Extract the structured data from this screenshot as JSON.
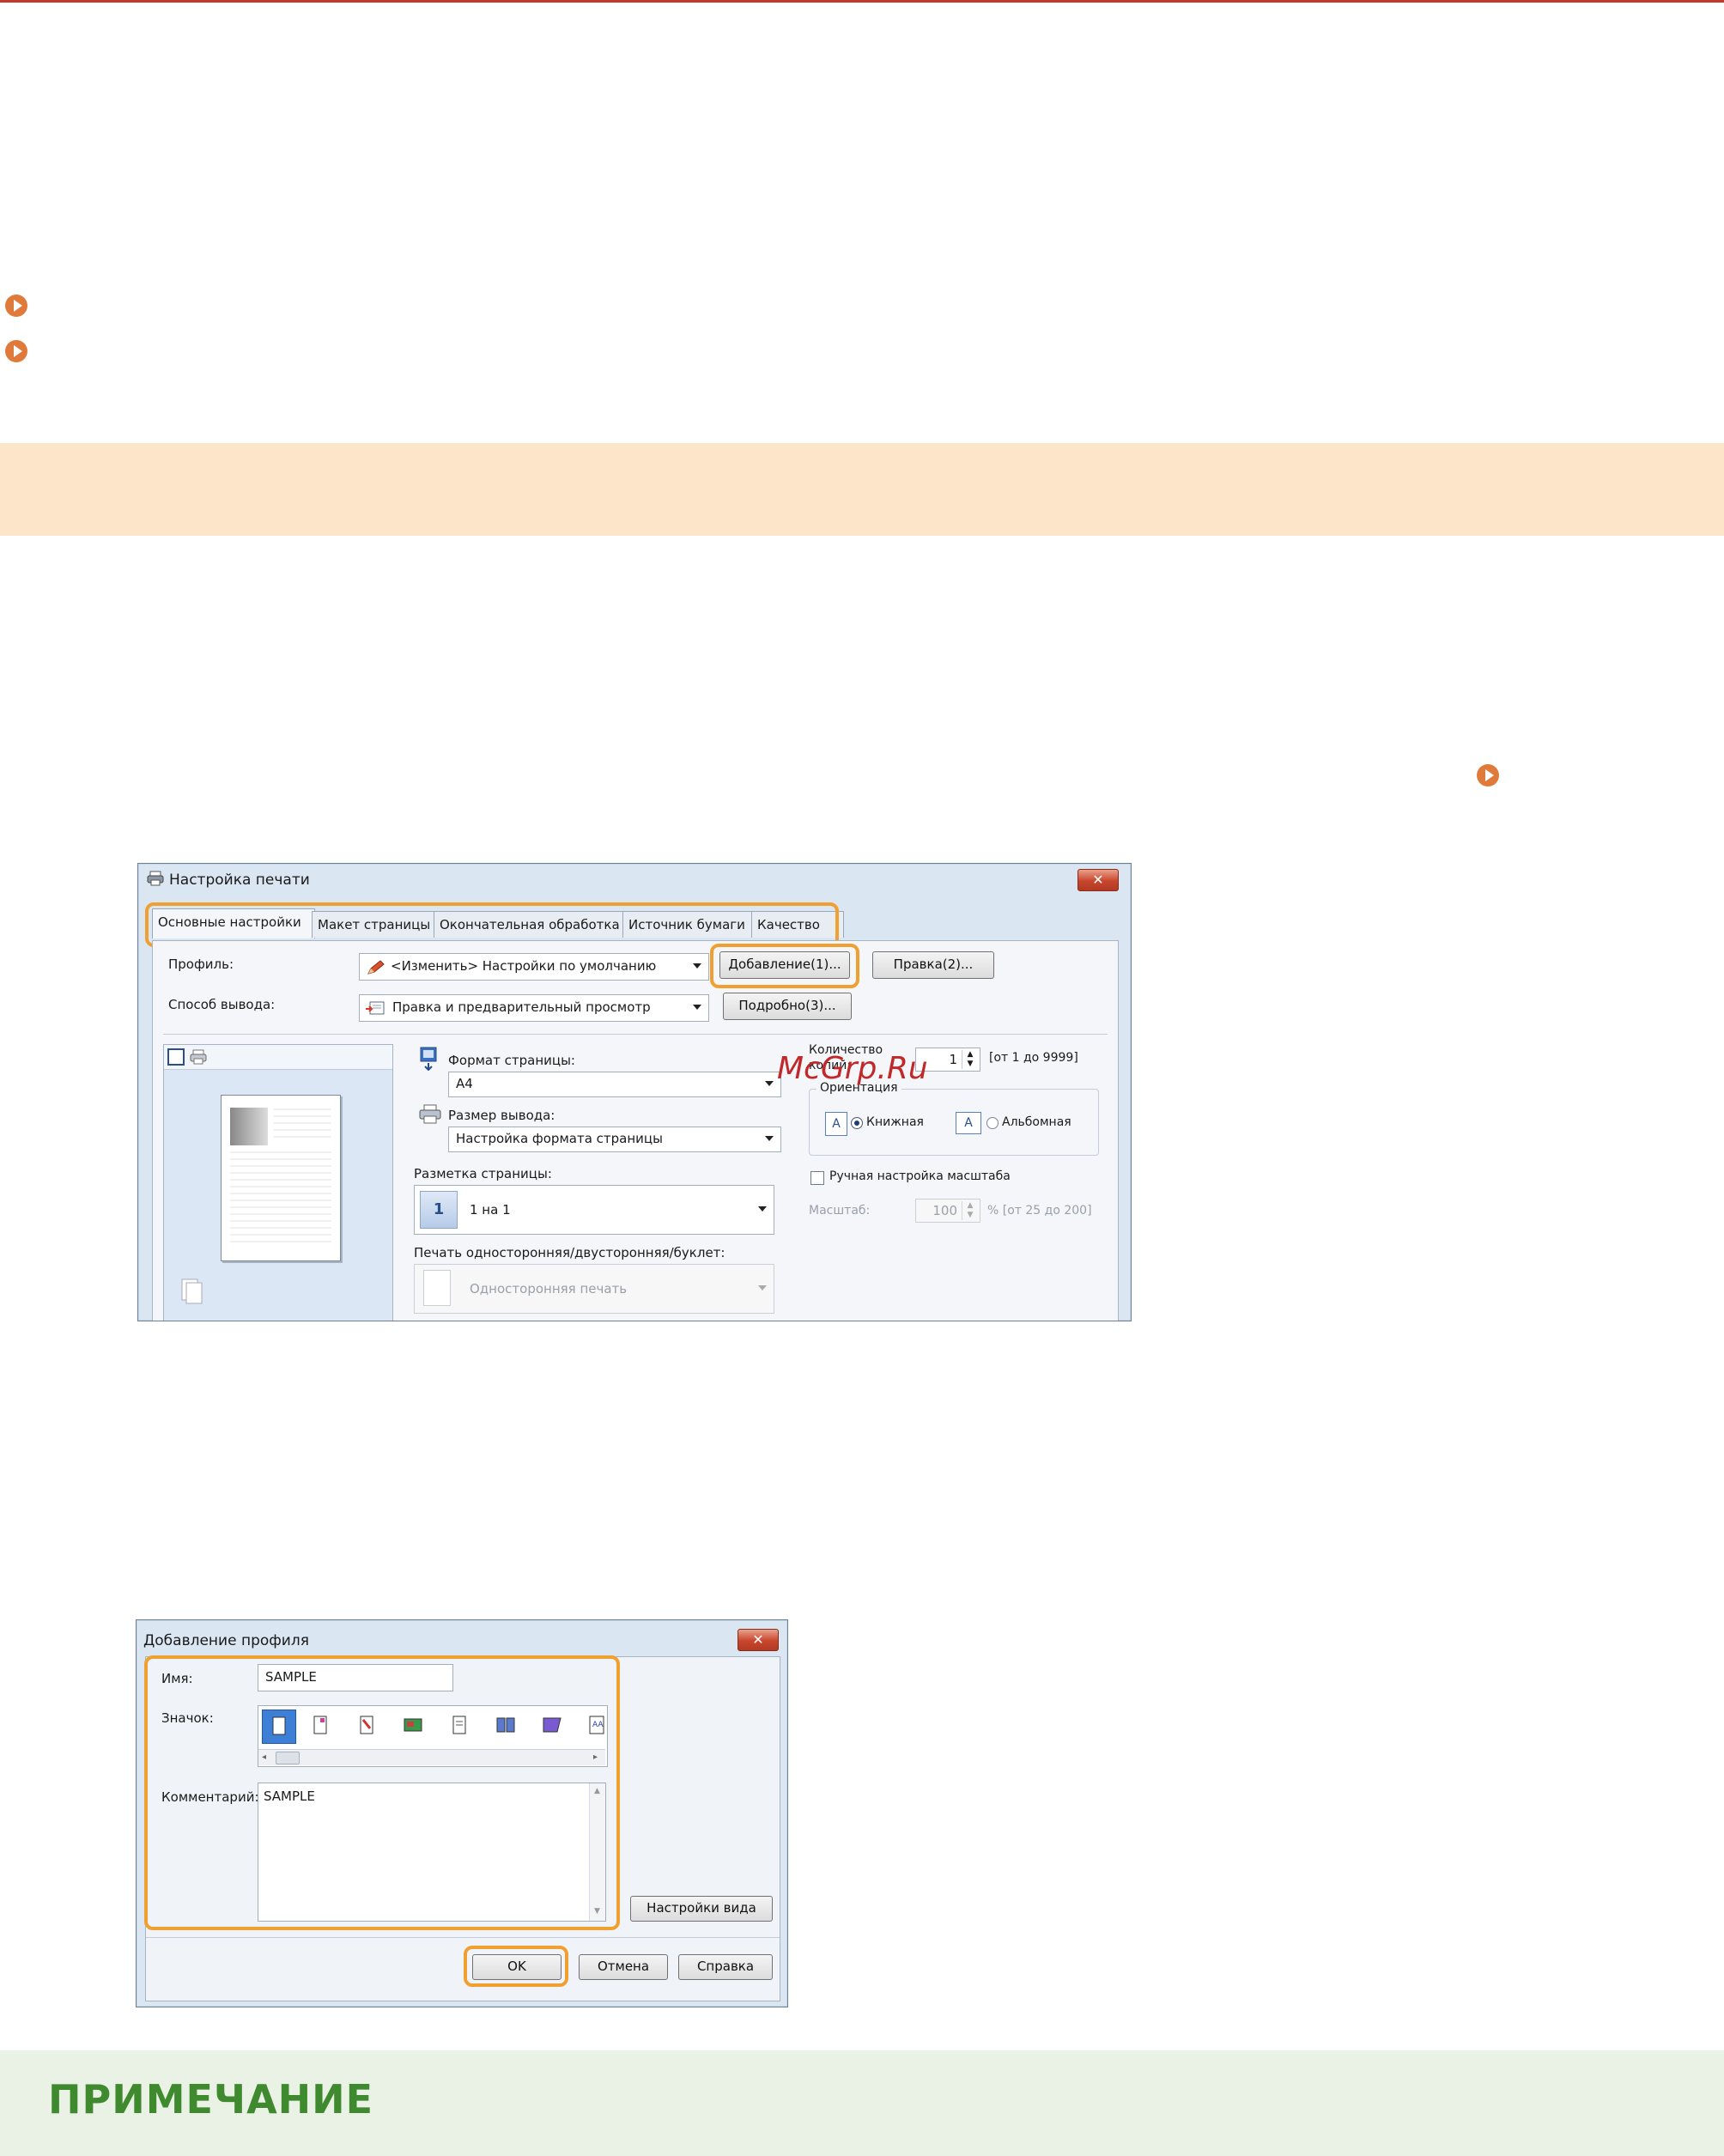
{
  "document": {
    "link_count": 2,
    "section_band_text": "",
    "note_heading": "ПРИМЕЧАНИЕ",
    "watermark": "McGrp.Ru"
  },
  "print_settings_dialog": {
    "title": "Настройка печати",
    "close_label": "✕",
    "tabs": [
      "Основные настройки",
      "Макет страницы",
      "Окончательная обработка",
      "Источник бумаги",
      "Качество"
    ],
    "profile_label": "Профиль:",
    "profile_value": "<Изменить> Настройки по умолчанию",
    "add_button": "Добавление(1)...",
    "edit_button": "Правка(2)...",
    "output_method_label": "Способ вывода:",
    "output_method_value": "Правка и предварительный просмотр",
    "details_button": "Подробно(3)...",
    "page_size_label": "Формат страницы:",
    "page_size_value": "A4",
    "output_size_label": "Размер вывода:",
    "output_size_value": "Настройка формата страницы",
    "layout_label": "Разметка страницы:",
    "layout_value": "1 на 1",
    "duplex_label": "Печать односторонняя/двусторонняя/буклет:",
    "duplex_value": "Односторонняя печать",
    "copies_label": "Количество копий:",
    "copies_value": "1",
    "copies_range": "[от 1 до 9999]",
    "orientation_label": "Ориентация",
    "portrait_label": "Книжная",
    "landscape_label": "Альбомная",
    "manual_scale_label": "Ручная настройка масштаба",
    "scale_label": "Масштаб:",
    "scale_value": "100",
    "scale_range": "% [от 25 до 200]"
  },
  "add_profile_dialog": {
    "title": "Добавление профиля",
    "close_label": "✕",
    "name_label": "Имя:",
    "name_value": "SAMPLE",
    "icon_label": "Значок:",
    "comment_label": "Комментарий:",
    "comment_value": "SAMPLE",
    "view_settings_button": "Настройки вида",
    "ok_button": "OK",
    "cancel_button": "Отмена",
    "help_button": "Справка"
  }
}
